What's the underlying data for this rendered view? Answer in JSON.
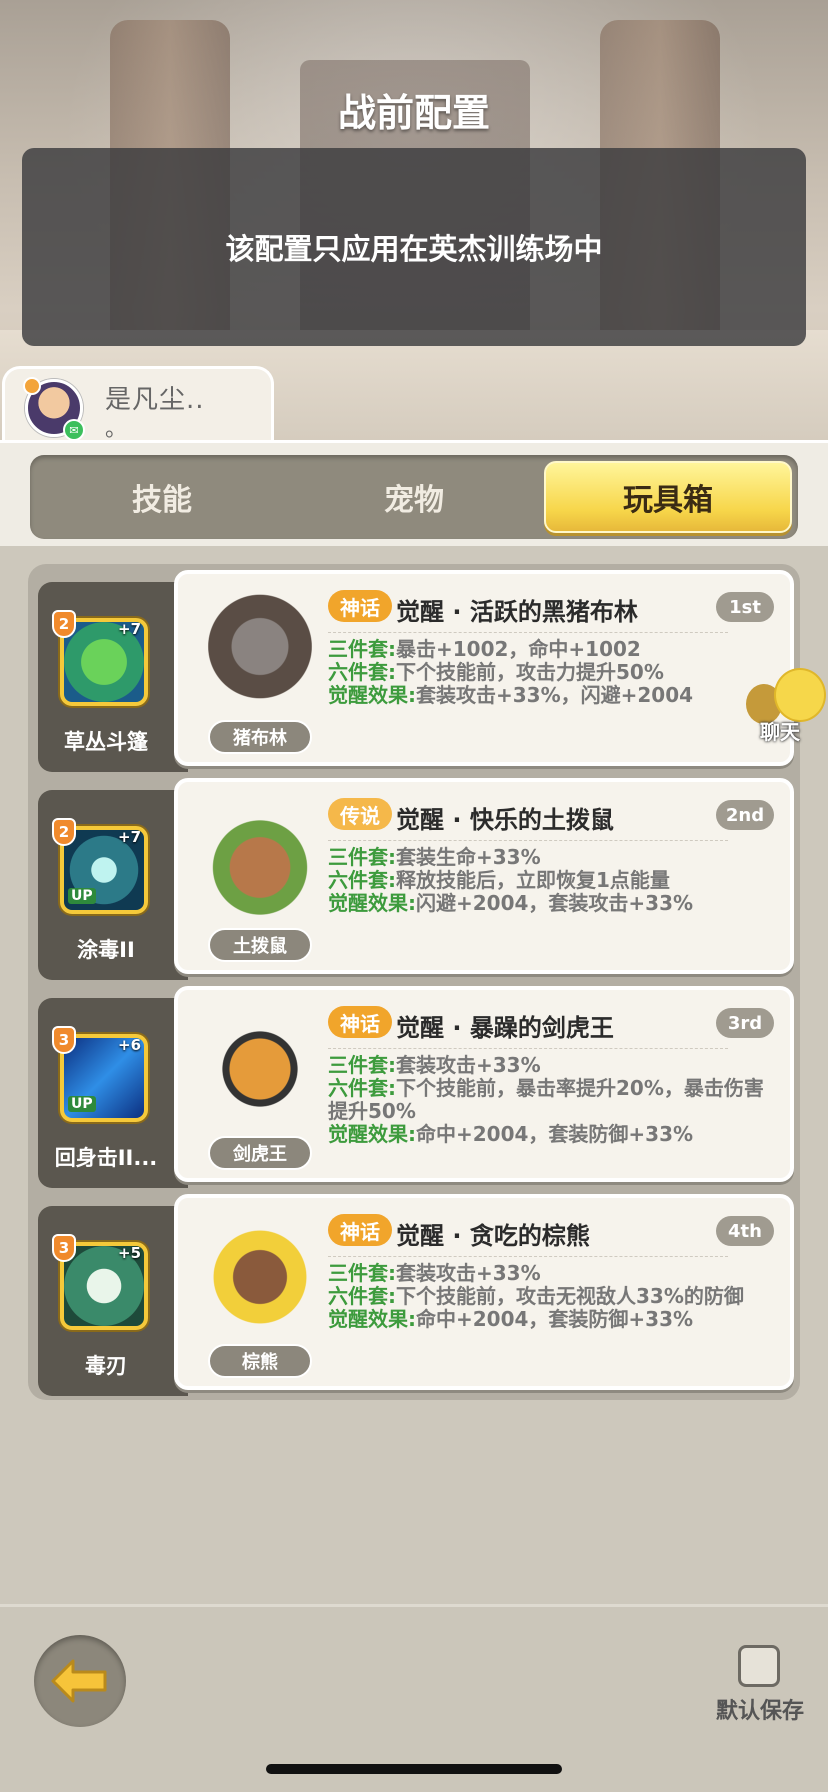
{
  "scene": {
    "title": "战前配置",
    "notice": "该配置只应用在英杰训练场中"
  },
  "player": {
    "name": "是凡尘..",
    "sub": "。"
  },
  "tabs": {
    "skill": "技能",
    "pet": "宠物",
    "toybox": "玩具箱",
    "active": "toybox"
  },
  "cards": [
    {
      "skill": {
        "name": "草丛斗篷",
        "level": "2",
        "plus": "+7",
        "up": "",
        "icon": "grass-cloak-icon"
      },
      "pet_label": "猪布林",
      "rarity": "神话",
      "rarity_color": "#f1a52b",
      "title": "觉醒 · 活跃的黑猪布林",
      "rank": "1st",
      "effects": [
        {
          "key": "三件套:",
          "text": "暴击+1002，命中+1002"
        },
        {
          "key": "六件套:",
          "text": "下个技能前，攻击力提升50%"
        },
        {
          "key": "觉醒效果:",
          "text": "套装攻击+33%，闪避+2004"
        }
      ]
    },
    {
      "skill": {
        "name": "涂毒II",
        "level": "2",
        "plus": "+7",
        "up": "UP",
        "icon": "poison-drop-icon"
      },
      "pet_label": "土拨鼠",
      "rarity": "传说",
      "rarity_color": "#f5b84a",
      "title": "觉醒 · 快乐的土拨鼠",
      "rank": "2nd",
      "effects": [
        {
          "key": "三件套:",
          "text": "套装生命+33%"
        },
        {
          "key": "六件套:",
          "text": "释放技能后，立即恢复1点能量"
        },
        {
          "key": "觉醒效果:",
          "text": "闪避+2004，套装攻击+33%"
        }
      ]
    },
    {
      "skill": {
        "name": "回身击II...",
        "level": "3",
        "plus": "+6",
        "up": "UP",
        "icon": "spin-slash-icon"
      },
      "pet_label": "剑虎王",
      "rarity": "神话",
      "rarity_color": "#f1a52b",
      "title": "觉醒 · 暴躁的剑虎王",
      "rank": "3rd",
      "effects": [
        {
          "key": "三件套:",
          "text": "套装攻击+33%"
        },
        {
          "key": "六件套:",
          "text": "下个技能前，暴击率提升20%，暴击伤害提升50%"
        },
        {
          "key": "觉醒效果:",
          "text": "命中+2004，套装防御+33%"
        }
      ]
    },
    {
      "skill": {
        "name": "毒刃",
        "level": "3",
        "plus": "+5",
        "up": "",
        "icon": "poison-blade-icon"
      },
      "pet_label": "棕熊",
      "rarity": "神话",
      "rarity_color": "#f1a52b",
      "title": "觉醒 · 贪吃的棕熊",
      "rank": "4th",
      "effects": [
        {
          "key": "三件套:",
          "text": "套装攻击+33%"
        },
        {
          "key": "六件套:",
          "text": "下个技能前，攻击无视敌人33%的防御"
        },
        {
          "key": "觉醒效果:",
          "text": "命中+2004，套装防御+33%"
        }
      ]
    }
  ],
  "chat": {
    "label": "聊天"
  },
  "bottom": {
    "save_label": "默认保存"
  }
}
